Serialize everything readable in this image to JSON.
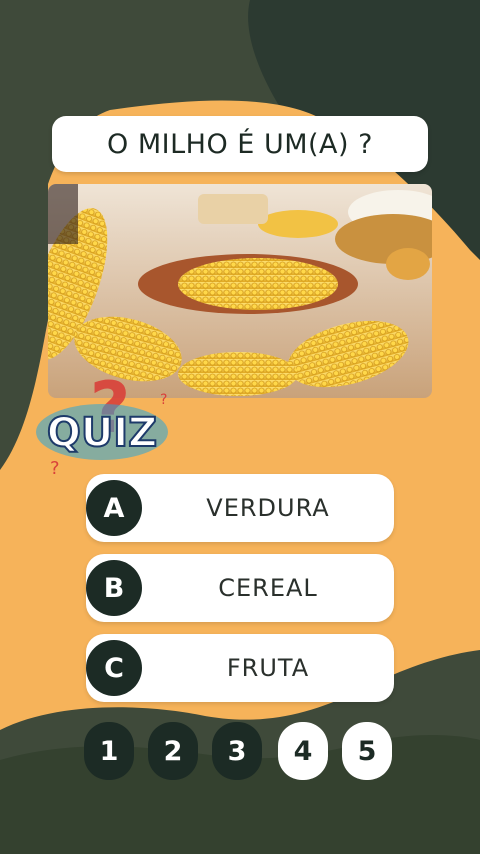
{
  "question": "O MILHO É UM(A) ?",
  "photo": {
    "description_icon": "corn-photo"
  },
  "logo": {
    "text": "QUIZ"
  },
  "options": [
    {
      "letter": "A",
      "label": "VERDURA"
    },
    {
      "letter": "B",
      "label": "CEREAL"
    },
    {
      "letter": "C",
      "label": "FRUTA"
    }
  ],
  "progress": {
    "steps": [
      "1",
      "2",
      "3",
      "4",
      "5"
    ],
    "completed_count": 3
  },
  "colors": {
    "dark_green": "#1c2b25",
    "olive": "#3f4a3a",
    "orange": "#f6b35a",
    "white": "#ffffff"
  }
}
